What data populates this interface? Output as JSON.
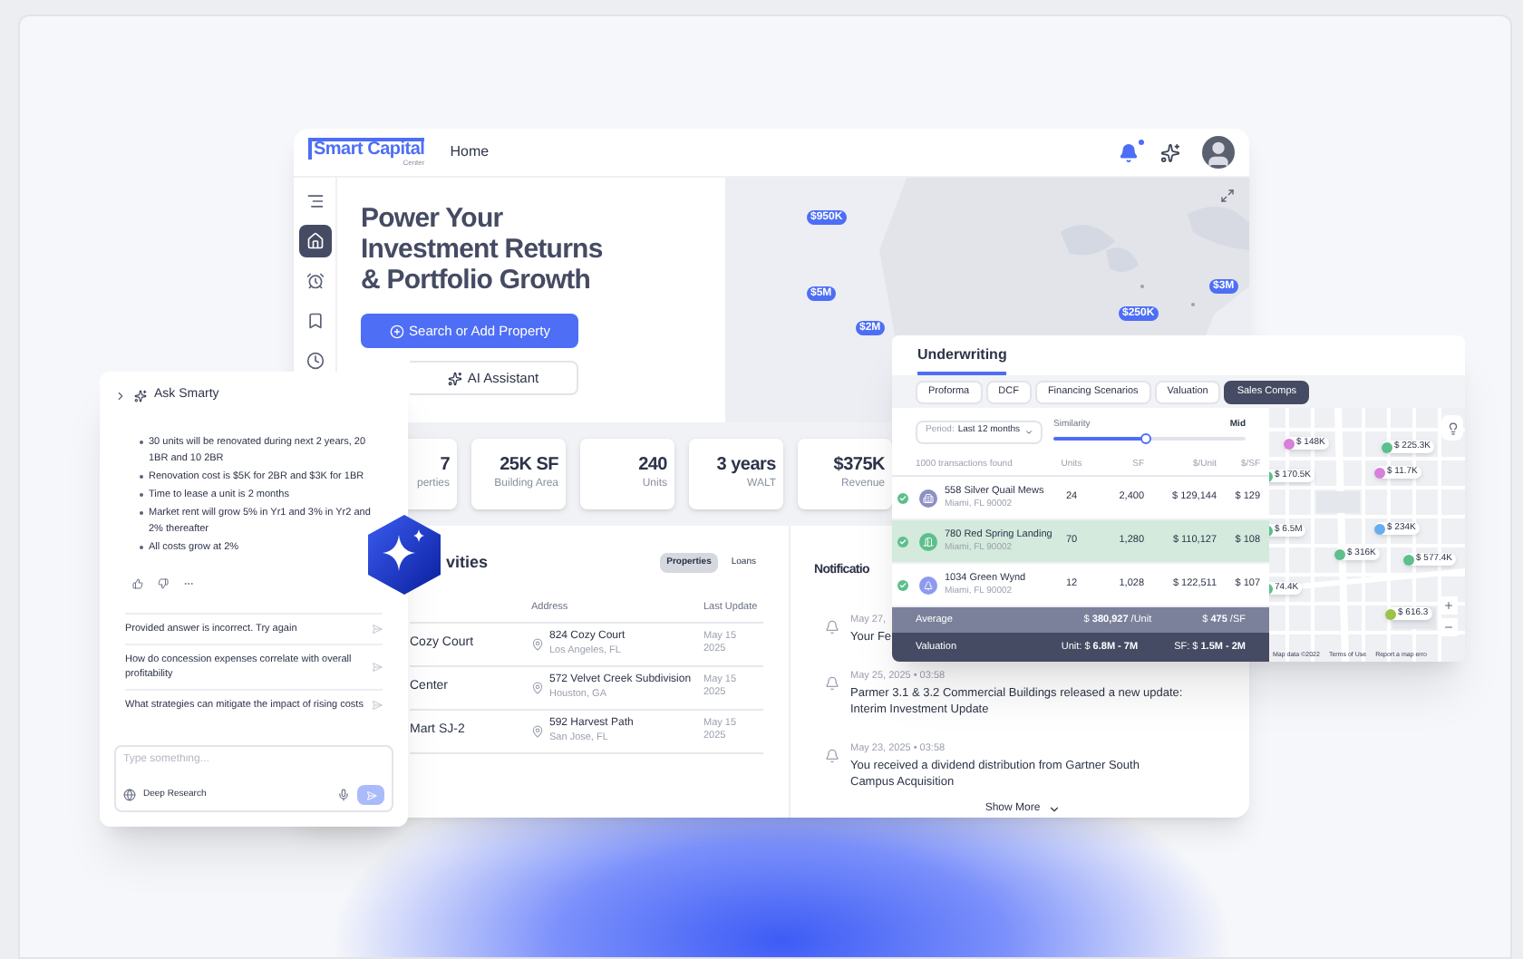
{
  "app": {
    "logo": "Smart Capital",
    "logo_sub": "Center",
    "nav": "Home",
    "unread": true
  },
  "sidebar_items": [
    {
      "kind": "toggle",
      "selected": false
    },
    {
      "kind": "home",
      "selected": true
    },
    {
      "kind": "alarm",
      "selected": false
    },
    {
      "kind": "bookmark",
      "selected": false
    },
    {
      "kind": "history",
      "selected": false
    }
  ],
  "hero": {
    "title": "Power Your Investment Returns & Portfolio Growth",
    "primary_button": "Search or Add Property",
    "secondary_button": "AI Assistant"
  },
  "map_pins": [
    "$950K",
    "$5M",
    "$2M",
    "$250K",
    "$3M"
  ],
  "stats": [
    {
      "value": "7",
      "label": "perties"
    },
    {
      "value": "25K SF",
      "label": "Building Area"
    },
    {
      "value": "240",
      "label": "Units"
    },
    {
      "value": "3 years",
      "label": "WALT"
    },
    {
      "value": "$375K",
      "label": "Revenue"
    }
  ],
  "activities": {
    "title": "vities",
    "tabs": [
      {
        "label": "Properties",
        "selected": true
      },
      {
        "label": "Loans",
        "selected": false
      }
    ],
    "columns": [
      "Address",
      "Last Update"
    ],
    "rows": [
      {
        "name": "Cozy Court",
        "address": "824 Cozy Court",
        "city": "Los Angeles, FL",
        "updated": "May 15 2025"
      },
      {
        "name": "Center",
        "address": "572 Velvet Creek Subdivision",
        "city": "Houston, GA",
        "updated": "May 15 2025"
      },
      {
        "name": "Mart SJ-2",
        "address": "592 Harvest Path",
        "city": "San Jose, FL",
        "updated": "May 15 2025"
      }
    ]
  },
  "notifications": {
    "title": "Notificatio",
    "items": [
      {
        "date": "May 27,",
        "text": "Your Fe"
      },
      {
        "date": "May 25, 2025 • 03:58",
        "text": "Parmer 3.1 & 3.2 Commercial Buildings released a new update: Interim Investment Update"
      },
      {
        "date": "May 23, 2025 • 03:58",
        "text": "You received a dividend distribution from Gartner South Campus Acquisition"
      }
    ],
    "more": "Show More"
  },
  "underwriting": {
    "title": "Underwriting",
    "tabs": [
      {
        "label": "Proforma",
        "selected": false
      },
      {
        "label": "DCF",
        "selected": false
      },
      {
        "label": "Financing Scenarios",
        "selected": false
      },
      {
        "label": "Valuation",
        "selected": false
      },
      {
        "label": "Sales Comps",
        "selected": true
      }
    ],
    "period_label": "Period:",
    "period": "Last 12 months",
    "similarity_label": "Similarity",
    "similarity": {
      "level": 0.48
    },
    "similarity_value": "Mid",
    "columns": [
      "1000 transactions found",
      "Units",
      "SF",
      "$/Unit",
      "$/SF"
    ],
    "rows": [
      {
        "name": "558 Silver Quail Mews",
        "city": "Miami, FL 90002",
        "units": "24",
        "sf": "2,400",
        "per_unit": "$ 129,144",
        "per_sf": "$ 129",
        "checked": true,
        "selected": false,
        "color": "#8d8fc4"
      },
      {
        "name": "780 Red Spring Landing",
        "city": "Miami, FL 90002",
        "units": "70",
        "sf": "1,280",
        "per_unit": "$ 110,127",
        "per_sf": "$ 108",
        "checked": true,
        "selected": true,
        "color": "#5cbf8c"
      },
      {
        "name": "1034 Green Wynd",
        "city": "Miami, FL 90002",
        "units": "12",
        "sf": "1,028",
        "per_unit": "$ 122,511",
        "per_sf": "$ 107",
        "checked": true,
        "selected": false,
        "color": "#8e9af0"
      }
    ],
    "average_label": "Average",
    "average_unit": "$ **380,927** /Unit",
    "average_sf": "$ **475** /SF",
    "valuation_label": "Valuation",
    "valuation_unit": "Unit: $ **6.8M - 7M**",
    "valuation_sf": "SF: $ **1.5M - 2M**",
    "map_pins": [
      {
        "label": "$ 148K",
        "color": "#d77fd9"
      },
      {
        "label": "$ 225.3K",
        "color": "#5cbf8c"
      },
      {
        "label": "$ 170.5K",
        "color": "#5cbf8c"
      },
      {
        "label": "$ 11.7K",
        "color": "#d77fd9"
      },
      {
        "label": "$ 6.5M",
        "color": "#5cbf8c"
      },
      {
        "label": "$ 234K",
        "color": "#66aef0"
      },
      {
        "label": "$ 316K",
        "color": "#5cbf8c"
      },
      {
        "label": "$ 577.4K",
        "color": "#5cbf8c"
      },
      {
        "label": "74.4K",
        "color": "#5cbf8c"
      },
      {
        "label": "$ 616.3",
        "color": "#9cc24a"
      }
    ],
    "attribution": [
      "Map data ©2022",
      "Terms of Use",
      "Report a map erro"
    ]
  },
  "chat": {
    "title": "Ask Smarty",
    "bullets": [
      "30 units will be renovated during next 2 years, 20 1BR and 10 2BR",
      "Renovation cost is $5K for 2BR and $3K for 1BR",
      "Time to lease a unit is 2 months",
      "Market rent will grow 5% in Yr1 and 3% in Yr2 and 2% thereafter",
      "All costs grow at 2%"
    ],
    "suggestions": [
      "Provided answer is incorrect. Try again",
      "How do concession expenses correlate with overall profitability",
      "What strategies can mitigate the impact of rising costs"
    ],
    "placeholder": "Type something...",
    "mode": "Deep Research"
  }
}
